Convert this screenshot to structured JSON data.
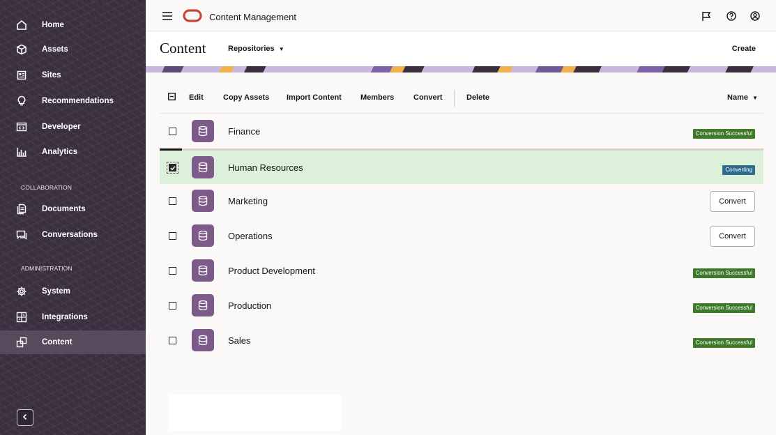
{
  "app": {
    "title": "Content Management"
  },
  "sidebar": {
    "items": [
      {
        "label": "Home",
        "icon": "home-icon"
      },
      {
        "label": "Assets",
        "icon": "cube-icon"
      },
      {
        "label": "Sites",
        "icon": "sites-icon"
      },
      {
        "label": "Recommendations",
        "icon": "lightbulb-icon"
      },
      {
        "label": "Developer",
        "icon": "code-icon"
      },
      {
        "label": "Analytics",
        "icon": "analytics-icon"
      }
    ],
    "collaboration_header": "COLLABORATION",
    "collaboration_items": [
      {
        "label": "Documents",
        "icon": "documents-icon"
      },
      {
        "label": "Conversations",
        "icon": "conversations-icon"
      }
    ],
    "administration_header": "ADMINISTRATION",
    "administration_items": [
      {
        "label": "System",
        "icon": "gear-icon"
      },
      {
        "label": "Integrations",
        "icon": "integrations-icon"
      },
      {
        "label": "Content",
        "icon": "content-icon",
        "active": true
      }
    ]
  },
  "page": {
    "title": "Content",
    "repositories_label": "Repositories",
    "create_label": "Create"
  },
  "toolbar": {
    "edit": "Edit",
    "copy_assets": "Copy Assets",
    "import_content": "Import Content",
    "members": "Members",
    "convert": "Convert",
    "delete": "Delete",
    "sort": "Name"
  },
  "repositories": [
    {
      "name": "Finance",
      "status": "Conversion Successful",
      "checked": false
    },
    {
      "name": "Human Resources",
      "status": "Converting",
      "checked": true
    },
    {
      "name": "Marketing",
      "action": "Convert",
      "checked": false
    },
    {
      "name": "Operations",
      "action": "Convert",
      "checked": false
    },
    {
      "name": "Product Development",
      "status": "Conversion Successful",
      "checked": false
    },
    {
      "name": "Production",
      "status": "Conversion Successful",
      "checked": false
    },
    {
      "name": "Sales",
      "status": "Conversion Successful",
      "checked": false
    }
  ],
  "colors": {
    "sidebar": "#3a2f3f",
    "repo_icon": "#7c5b8a",
    "success_badge": "#3d7a2a",
    "converting_badge": "#2d6b8f",
    "selected_row": "#ddf0d9",
    "oracle_logo": "#c74634"
  }
}
